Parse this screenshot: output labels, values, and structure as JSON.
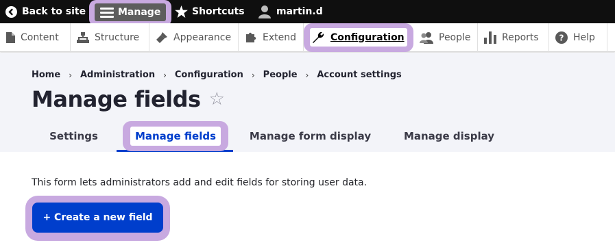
{
  "toolbar": {
    "back_label": "Back to site",
    "manage_label": "Manage",
    "shortcuts_label": "Shortcuts",
    "user_label": "martin.d"
  },
  "admin_menu": {
    "items": [
      {
        "label": "Content",
        "icon": "content-icon"
      },
      {
        "label": "Structure",
        "icon": "structure-icon"
      },
      {
        "label": "Appearance",
        "icon": "appearance-icon"
      },
      {
        "label": "Extend",
        "icon": "extend-icon"
      },
      {
        "label": "Configuration",
        "icon": "wrench-icon",
        "active": true
      },
      {
        "label": "People",
        "icon": "people-icon"
      },
      {
        "label": "Reports",
        "icon": "reports-icon"
      },
      {
        "label": "Help",
        "icon": "help-icon"
      }
    ]
  },
  "breadcrumb": [
    "Home",
    "Administration",
    "Configuration",
    "People",
    "Account settings"
  ],
  "breadcrumb_separator": "›",
  "page": {
    "title": "Manage fields",
    "star": "☆",
    "description": "This form lets administrators add and edit fields for storing user data."
  },
  "tabs": [
    {
      "label": "Settings"
    },
    {
      "label": "Manage fields",
      "active": true
    },
    {
      "label": "Manage form display"
    },
    {
      "label": "Manage display"
    }
  ],
  "actions": {
    "create_label": "+ Create a new field"
  },
  "colors": {
    "accent": "#003ecc",
    "highlight": "#c8a9e0",
    "toolbar_bg": "#0f0f0f",
    "header_bg": "#f3f4f9"
  }
}
